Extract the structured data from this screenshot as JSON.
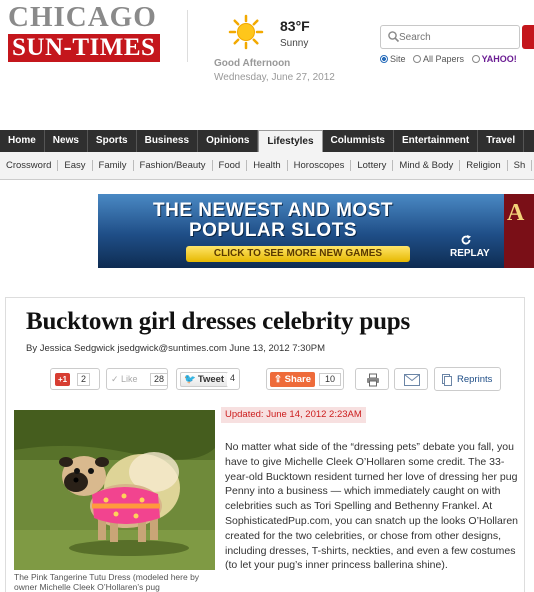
{
  "masthead": {
    "logo_top": "CHICAGO",
    "logo_bottom": "SUN-TIMES"
  },
  "weather": {
    "temperature": "83°F",
    "condition": "Sunny",
    "greeting": "Good Afternoon",
    "date": "Wednesday, June 27, 2012"
  },
  "search": {
    "placeholder": "Search",
    "options": [
      "Site",
      "All Papers",
      "YAHOO!"
    ],
    "selected": "Site"
  },
  "nav": {
    "items": [
      "Home",
      "News",
      "Sports",
      "Business",
      "Opinions",
      "Lifestyles",
      "Columnists",
      "Entertainment",
      "Travel"
    ],
    "active": "Lifestyles"
  },
  "subnav": {
    "items": [
      "Crossword",
      "Easy",
      "Family",
      "Fashion/Beauty",
      "Food",
      "Health",
      "Horoscopes",
      "Lottery",
      "Mind & Body",
      "Religion",
      "Sh"
    ]
  },
  "ad": {
    "line1": "THE NEWEST AND MOST",
    "line2": "POPULAR SLOTS",
    "cta": "CLICK TO SEE MORE NEW GAMES",
    "replay": "REPLAY",
    "side_letter": "A"
  },
  "article": {
    "headline": "Bucktown girl dresses celebrity pups",
    "byline": "By Jessica Sedgwick jsedgwick@suntimes.com June 13, 2012 7:30PM",
    "updated": "Updated: June 14, 2012 2:23AM",
    "body": "No matter what side of the “dressing pets” debate you fall, you have to give Michelle Cleek O’Hollaren some credit. The 33-year-old Bucktown resident turned her love of dressing her pug Penny into a business — which immediately caught on with celebrities such as Tori Spelling and Bethenny Frankel. At SophisticatedPup.com, you can snatch up the looks O’Hollaren created for the two celebrities, or chose from other designs, including dresses, T-shirts, neckties, and even a few costumes (to let your pug’s inner princess ballerina shine).",
    "photo_caption": "The Pink Tangerine Tutu Dress (modeled here by owner Michelle Cleek O’Hollaren’s pug"
  },
  "share": {
    "gplus_label": "+1",
    "gplus_count": "2",
    "like_label": "Like",
    "like_count": "28",
    "tweet_label": "Tweet",
    "tweet_count": "4",
    "share_label": "Share",
    "share_count": "10",
    "reprints_label": "Reprints"
  },
  "colors": {
    "brand_red": "#c4161c",
    "nav_dark": "#2f2f2f",
    "link_blue": "#1f4e87"
  }
}
